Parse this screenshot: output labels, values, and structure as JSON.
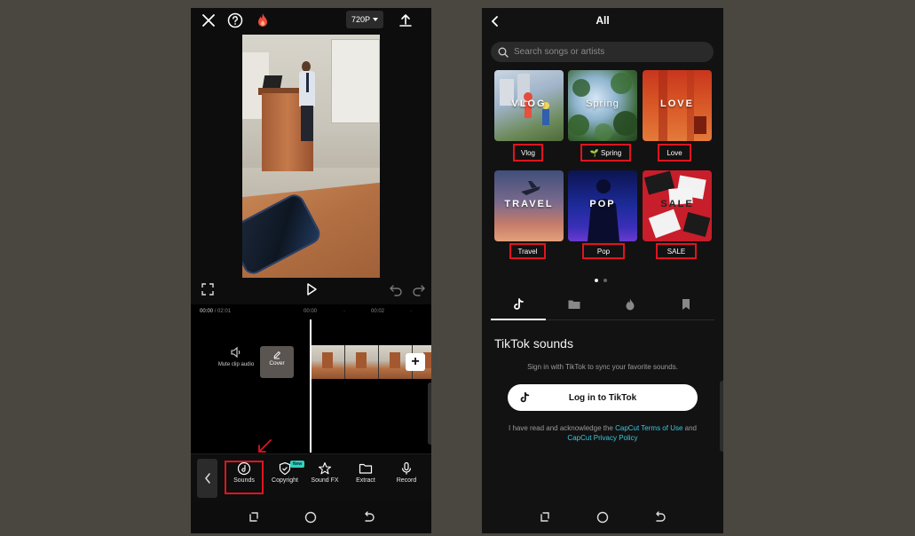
{
  "left": {
    "top_bar": {
      "resolution": "720P"
    },
    "timeline": {
      "current": "00:00",
      "total": "/ 02:01",
      "mark1": "00:00",
      "mark2": "00:02",
      "dot": "·"
    },
    "mute_label": "Mute clip audio",
    "cover_label": "Cover",
    "add_clip": "+",
    "toolbar": {
      "sounds": "Sounds",
      "copyright": "Copyright",
      "new_badge": "New",
      "sound_fx": "Sound FX",
      "extract": "Extract",
      "record": "Record"
    }
  },
  "right": {
    "title": "All",
    "search_placeholder": "Search songs or artists",
    "categories": [
      {
        "art": "VLOG",
        "label": "Vlog"
      },
      {
        "art": "Spring",
        "label": "🌱 Spring"
      },
      {
        "art": "LOVE",
        "label": "Love"
      },
      {
        "art": "TRAVEL",
        "label": "Travel"
      },
      {
        "art": "POP",
        "label": "Pop"
      },
      {
        "art": "SALE",
        "label": "SALE"
      }
    ],
    "tiktok": {
      "title": "TikTok sounds",
      "subtitle": "Sign in with TikTok to sync your favorite sounds.",
      "login": "Log in to TikTok",
      "terms_prefix": "I have read and acknowledge the ",
      "terms_link": "CapCut Terms of Use",
      "terms_and": " and ",
      "privacy_link": "CapCut Privacy Policy"
    }
  },
  "colors": {
    "highlight": "#e0141e",
    "accent": "#3cc7e0",
    "badge": "#33d1c1"
  }
}
